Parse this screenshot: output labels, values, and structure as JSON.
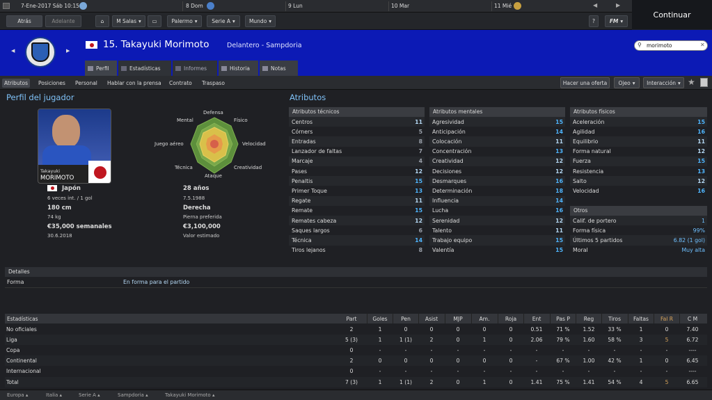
{
  "topbar": {
    "date": "7-Ene-2017 Sáb 10:15",
    "days": [
      "8 Dom",
      "9 Lun",
      "10 Mar",
      "11 Mié"
    ]
  },
  "continue_label": "Continuar",
  "nav": {
    "back": "Atrás",
    "forward": "Adelante",
    "manager": "M Salas",
    "club": "Palermo",
    "league": "Serie A",
    "world": "Mundo",
    "help": "?",
    "fm": "FM"
  },
  "header": {
    "number_name": "15. Takayuki Morimoto",
    "position_club": "Delantero - Sampdoria",
    "search_value": "morimoto"
  },
  "tabs": [
    "Perfil",
    "Estadísticas",
    "Informes",
    "Historia",
    "Notas"
  ],
  "subnav": [
    "Atributos",
    "Posiciones",
    "Personal",
    "Hablar con la prensa",
    "Contrato",
    "Traspaso"
  ],
  "actions": {
    "offer": "Hacer una oferta",
    "scout": "Ojeo",
    "interaction": "Interacción"
  },
  "profile": {
    "title": "Perfil del jugador",
    "card_first": "Takayuki",
    "card_last": "MORIMOTO",
    "country": "Japón",
    "caps": "6 veces int. / 1 gol",
    "age": "28 años",
    "dob": "7.5.1988",
    "height": "180 cm",
    "weight": "74 kg",
    "foot": "Derecha",
    "foot_label": "Pierna preferida",
    "wage": "€35,000 semanales",
    "contract": "30.6.2018",
    "value": "€3,100,000",
    "value_label": "Valor estimado"
  },
  "radar": {
    "labels": [
      "Defensa",
      "Físico",
      "Velocidad",
      "Creatividad",
      "Ataque",
      "Técnica",
      "Juego aéreo",
      "Mental"
    ]
  },
  "attributes": {
    "title": "Atributos",
    "technical": {
      "header": "Atributos técnicos",
      "items": [
        [
          "Centros",
          "11"
        ],
        [
          "Córners",
          "5"
        ],
        [
          "Entradas",
          "8"
        ],
        [
          "Lanzador de faltas",
          "7"
        ],
        [
          "Marcaje",
          "4"
        ],
        [
          "Pases",
          "12"
        ],
        [
          "Penaltis",
          "15"
        ],
        [
          "Primer Toque",
          "13"
        ],
        [
          "Regate",
          "11"
        ],
        [
          "Remate",
          "15"
        ],
        [
          "Remates cabeza",
          "12"
        ],
        [
          "Saques largos",
          "6"
        ],
        [
          "Técnica",
          "14"
        ],
        [
          "Tiros lejanos",
          "8"
        ]
      ]
    },
    "mental": {
      "header": "Atributos mentales",
      "items": [
        [
          "Agresividad",
          "15"
        ],
        [
          "Anticipación",
          "14"
        ],
        [
          "Colocación",
          "11"
        ],
        [
          "Concentración",
          "13"
        ],
        [
          "Creatividad",
          "12"
        ],
        [
          "Decisiones",
          "12"
        ],
        [
          "Desmarques",
          "16"
        ],
        [
          "Determinación",
          "18"
        ],
        [
          "Influencia",
          "14"
        ],
        [
          "Lucha",
          "16"
        ],
        [
          "Serenidad",
          "12"
        ],
        [
          "Talento",
          "11"
        ],
        [
          "Trabajo equipo",
          "15"
        ],
        [
          "Valentía",
          "15"
        ]
      ]
    },
    "physical": {
      "header": "Atributos físicos",
      "items": [
        [
          "Aceleración",
          "15"
        ],
        [
          "Agilidad",
          "16"
        ],
        [
          "Equilibrio",
          "11"
        ],
        [
          "Forma natural",
          "12"
        ],
        [
          "Fuerza",
          "15"
        ],
        [
          "Resistencia",
          "13"
        ],
        [
          "Salto",
          "12"
        ],
        [
          "Velocidad",
          "16"
        ]
      ]
    },
    "other": {
      "header": "Otros",
      "items": [
        [
          "Calif. de portero",
          "1"
        ],
        [
          "Forma física",
          "99%"
        ],
        [
          "Últimos 5 partidos",
          "6.82 (1 gol)"
        ],
        [
          "Moral",
          "Muy alta"
        ]
      ]
    }
  },
  "details": {
    "header": "Detalles",
    "label": "Forma",
    "value": "En forma para el partido"
  },
  "stats": {
    "header": "Estadísticas",
    "columns": [
      "Part",
      "Goles",
      "Pen",
      "Asist",
      "MJP",
      "Am.",
      "Roja",
      "Ent",
      "Pas P",
      "Reg",
      "Tiros",
      "Faltas",
      "Fal R",
      "C M"
    ],
    "rows": [
      {
        "label": "No oficiales",
        "cells": [
          "2",
          "1",
          "0",
          "0",
          "0",
          "0",
          "0",
          "0.51",
          "71 %",
          "1.52",
          "33 %",
          "1",
          "0",
          "7.40"
        ]
      },
      {
        "label": "Liga",
        "cells": [
          "5 (3)",
          "1",
          "1 (1)",
          "2",
          "0",
          "1",
          "0",
          "2.06",
          "79 %",
          "1.60",
          "58 %",
          "3",
          "5",
          "6.72"
        ]
      },
      {
        "label": "Copa",
        "cells": [
          "0",
          "-",
          "-",
          "-",
          "-",
          "-",
          "-",
          "-",
          "-",
          "-",
          "-",
          "-",
          "-",
          "----"
        ]
      },
      {
        "label": "Continental",
        "cells": [
          "2",
          "0",
          "0",
          "0",
          "0",
          "0",
          "0",
          "-",
          "67 %",
          "1.00",
          "42 %",
          "1",
          "0",
          "6.45"
        ]
      },
      {
        "label": "Internacional",
        "cells": [
          "0",
          "-",
          "-",
          "-",
          "-",
          "-",
          "-",
          "-",
          "-",
          "-",
          "-",
          "-",
          "-",
          "----"
        ]
      },
      {
        "label": "Total",
        "cells": [
          "7 (3)",
          "1",
          "1 (1)",
          "2",
          "0",
          "1",
          "0",
          "1.41",
          "75 %",
          "1.41",
          "54 %",
          "4",
          "5",
          "6.65"
        ]
      }
    ]
  },
  "breadcrumbs": [
    "Europa",
    "Italia",
    "Serie A",
    "Sampdoria",
    "Takayuki Morimoto"
  ]
}
